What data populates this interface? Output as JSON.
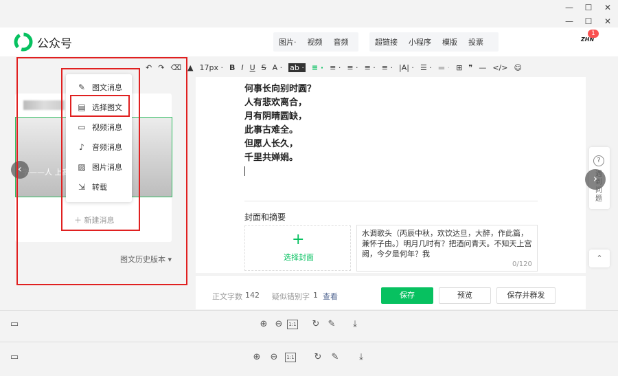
{
  "window": {
    "minimize": "—",
    "maximize": "☐",
    "close": "✕"
  },
  "header": {
    "brand": "公众号",
    "menu_group1": [
      "图片·",
      "视频",
      "音频"
    ],
    "menu_group2": [
      "超链接",
      "小程序",
      "模版",
      "投票"
    ],
    "avatar_text": "ZHN",
    "badge": "1"
  },
  "toolbar": {
    "undo": "↶",
    "redo": "↷",
    "eraser": "⌫",
    "brush": "▲",
    "font_size": "17px ·",
    "bold": "B",
    "italic": "I",
    "underline": "U",
    "strike": "S",
    "font_color": "A ·",
    "bg_color": "ab ·",
    "align": "≡ ·",
    "indent": "≡ ·",
    "line_spacing": "≡ ·",
    "para": "≡ ·",
    "list": "≡ ·",
    "letter_spacing": "|A| ·",
    "bullets": "☰ ·",
    "divider": "▬ ·",
    "table": "⊞",
    "quote": "❞",
    "line": "—",
    "code": "</>",
    "emoji": "☺"
  },
  "left": {
    "blurred_title": "",
    "cover_text": "学——人         上高水平的四十首诗",
    "new_message": "新建消息",
    "history": "图文历史版本 ▾"
  },
  "popup": {
    "items": [
      {
        "icon": "✎",
        "label": "图文消息"
      },
      {
        "icon": "▤",
        "label": "选择图文"
      },
      {
        "icon": "▭",
        "label": "视频消息"
      },
      {
        "icon": "♪",
        "label": "音频消息"
      },
      {
        "icon": "▨",
        "label": "图片消息"
      },
      {
        "icon": "⇲",
        "label": "转载"
      }
    ]
  },
  "editor": {
    "poem": [
      "何事长向别时圆？",
      "人有悲欢离合，",
      "月有阴晴圆缺，",
      "此事古难全。",
      "但愿人长久，",
      "千里共婵娟。"
    ],
    "section_title": "封面和摘要",
    "cover_plus": "+",
    "cover_label": "选择封面",
    "summary": "水调歌头（丙辰中秋，欢饮达旦，大醉，作此篇，兼怀子由。）明月几时有？把酒问青天。不知天上宫阙，今夕是何年？我",
    "summary_count": "0/120"
  },
  "footer": {
    "word_count_label": "正文字数",
    "word_count": "142",
    "typo_label": "疑似错别字",
    "typo_count": "1",
    "view_link": "查看",
    "save": "保存",
    "preview": "预览",
    "save_send": "保存并群发"
  },
  "right_float": {
    "help": "?",
    "text": "遇到问题",
    "top": "⌃"
  },
  "viewer": {
    "panel": "▭",
    "zoom_in": "⊕",
    "zoom_out": "⊖",
    "actual": "1:1",
    "rotate": "↻",
    "edit": "✎",
    "download": "⤓"
  },
  "colors": {
    "accent": "#07c160",
    "red_box": "#e02020",
    "link": "#576b95"
  }
}
